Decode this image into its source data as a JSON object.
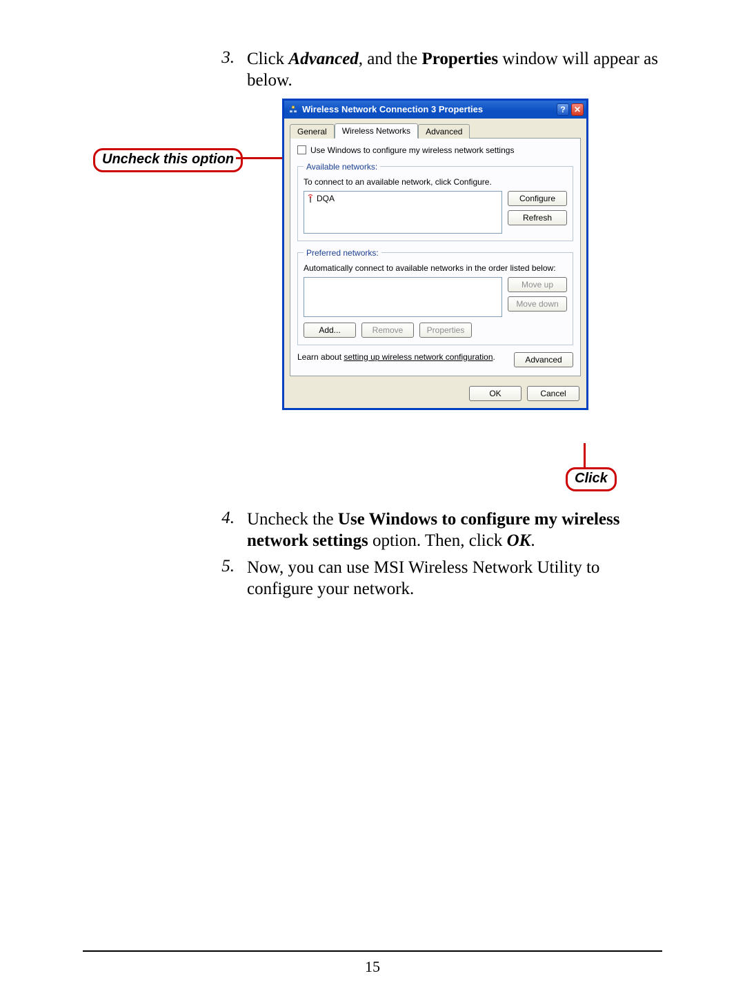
{
  "steps": {
    "s3": {
      "num": "3.",
      "t1": "Click ",
      "t2": "Advanced",
      "t3": ", and the ",
      "t4": "Properties",
      "t5": " window will appear as below."
    },
    "s4": {
      "num": "4.",
      "t1": "Uncheck the ",
      "t2": "Use Windows to configure my wireless network settings",
      "t3": " option.  Then, click ",
      "t4": "OK",
      "t5": "."
    },
    "s5": {
      "num": "5.",
      "t1": "Now, you can use MSI Wireless Network Utility to configure your network."
    }
  },
  "callouts": {
    "uncheck": "Uncheck this option",
    "click": "Click"
  },
  "dialog": {
    "title": "Wireless Network Connection 3 Properties",
    "help_glyph": "?",
    "close_glyph": "✕",
    "tabs": {
      "general": "General",
      "wireless": "Wireless Networks",
      "advanced": "Advanced"
    },
    "checkbox_label": "Use Windows to configure my wireless network settings",
    "available": {
      "legend": "Available networks:",
      "desc": "To connect to an available network, click Configure.",
      "item0": "DQA",
      "configure": "Configure",
      "refresh": "Refresh"
    },
    "preferred": {
      "legend": "Preferred networks:",
      "desc": "Automatically connect to available networks in the order listed below:",
      "moveup": "Move up",
      "movedown": "Move down",
      "add": "Add...",
      "remove": "Remove",
      "properties": "Properties"
    },
    "learn": {
      "prefix": "Learn about ",
      "link": "setting up wireless network configuration",
      "suffix": "."
    },
    "advanced_btn": "Advanced",
    "ok": "OK",
    "cancel": "Cancel"
  },
  "page_number": "15"
}
